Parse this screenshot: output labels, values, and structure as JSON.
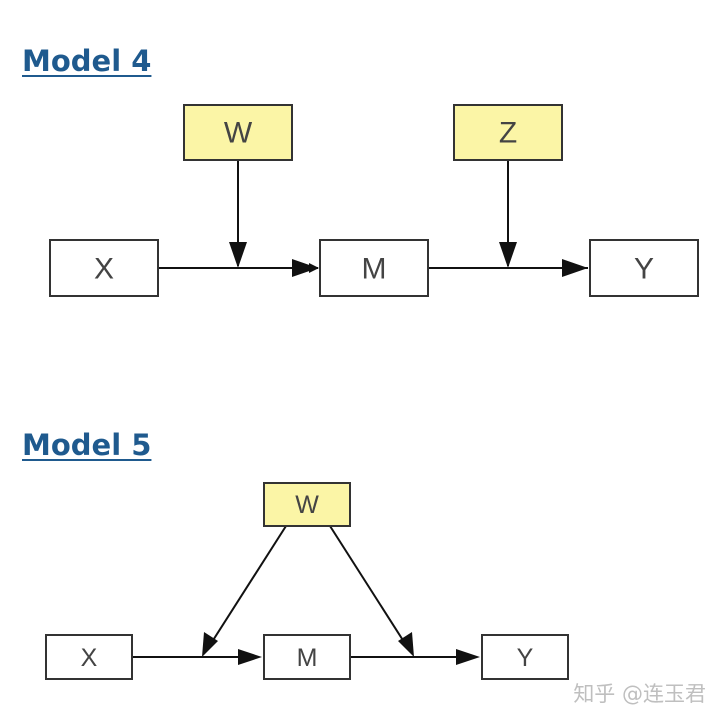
{
  "models": [
    {
      "title": "Model 4",
      "nodes": {
        "x": "X",
        "w": "W",
        "m": "M",
        "z": "Z",
        "y": "Y"
      }
    },
    {
      "title": "Model 5",
      "nodes": {
        "x": "X",
        "w": "W",
        "m": "M",
        "y": "Y"
      }
    }
  ],
  "colors": {
    "title": "#1f5a8e",
    "moderator_fill": "#fbf5a6",
    "plain_fill": "#ffffff",
    "edge": "#111111",
    "box_stroke": "#333333"
  },
  "watermark": "知乎 @连玉君"
}
